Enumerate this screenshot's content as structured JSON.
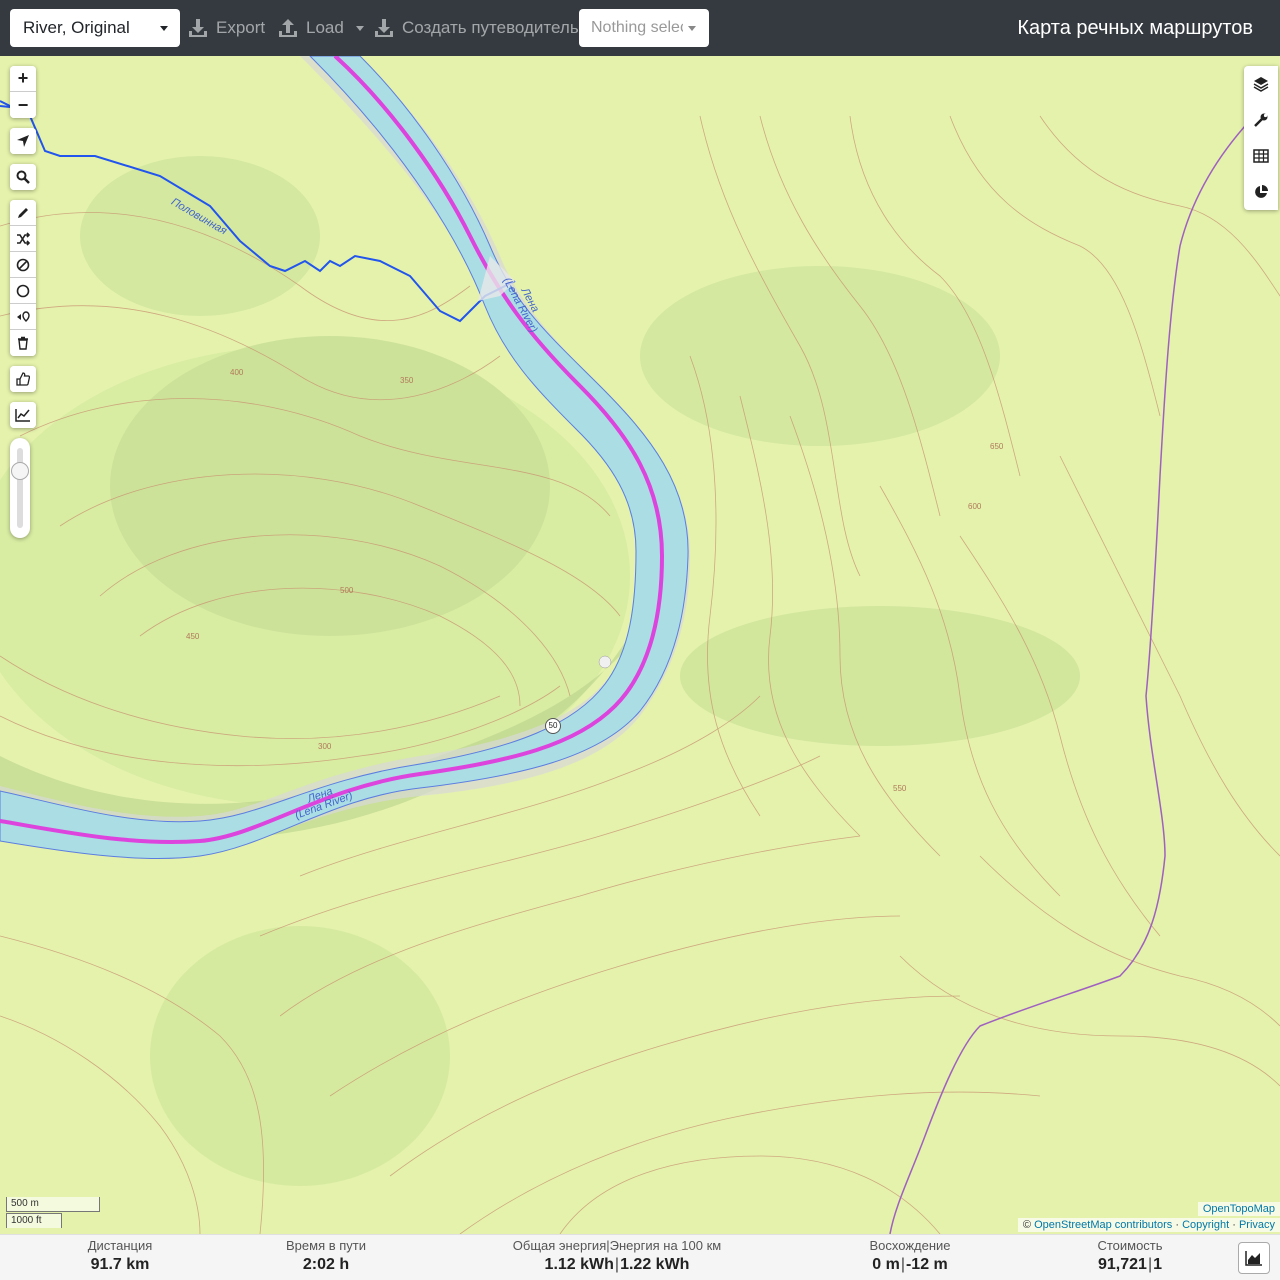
{
  "navbar": {
    "profile": "River, Original",
    "export_label": "Export",
    "load_label": "Load",
    "guide_label": "Создать путеводитель",
    "poi_placeholder": "Nothing selected",
    "title": "Карта речных маршрутов"
  },
  "map": {
    "labels": {
      "river_ru_top": "Лена",
      "river_en_top": "(Lena River)",
      "river_ru_bottom": "Лена",
      "river_en_bottom": "(Lena River)",
      "stream": "Половинная",
      "km_marker": "50"
    },
    "contours": [
      "400",
      "350",
      "300",
      "450",
      "500",
      "550",
      "600",
      "650"
    ],
    "colors": {
      "river_fill": "#aadde4",
      "route": "#dd44dd",
      "stream": "#2255ee",
      "boundary": "#a060c0",
      "terrain": "#e4f2ac",
      "contour": "#c89070"
    }
  },
  "controls": {
    "zoom_in": "+",
    "zoom_out": "−",
    "left_icons": [
      "locate-icon",
      "search-icon",
      "draw-icon",
      "shuffle-icon",
      "no-go-icon",
      "circle-icon",
      "reverse-icon",
      "trash-icon",
      "thumb-icon",
      "profile-chart-icon"
    ],
    "right_icons": [
      "layers-icon",
      "wrench-icon",
      "table-icon",
      "pie-chart-icon"
    ]
  },
  "scale": {
    "metric": "500 m",
    "imperial": "1000 ft"
  },
  "attribution": {
    "tiles": "OpenTopoMap",
    "copy": "©",
    "osm": "OpenStreetMap contributors",
    "dot1": "·",
    "copyright": "Copyright",
    "dot2": "·",
    "privacy": "Privacy"
  },
  "stats": {
    "distance": {
      "label": "Дистанция",
      "value": "91.7",
      "unit": "km"
    },
    "time": {
      "label": "Время в пути",
      "value": "2:02",
      "unit": "h"
    },
    "energy": {
      "label": "Общая энергия",
      "label_sep": "|",
      "label2": "Энергия на 100 км",
      "value": "1.12",
      "unit": "kWh",
      "sep": "|",
      "value2": "1.22",
      "unit2": "kWh"
    },
    "ascent": {
      "label": "Восхождение",
      "value": "0",
      "unit": "m",
      "sep": "|",
      "value2": "-12",
      "unit2": "m"
    },
    "cost": {
      "label": "Стоимость",
      "value": "91,721",
      "sep": "|",
      "value2": "1"
    }
  }
}
